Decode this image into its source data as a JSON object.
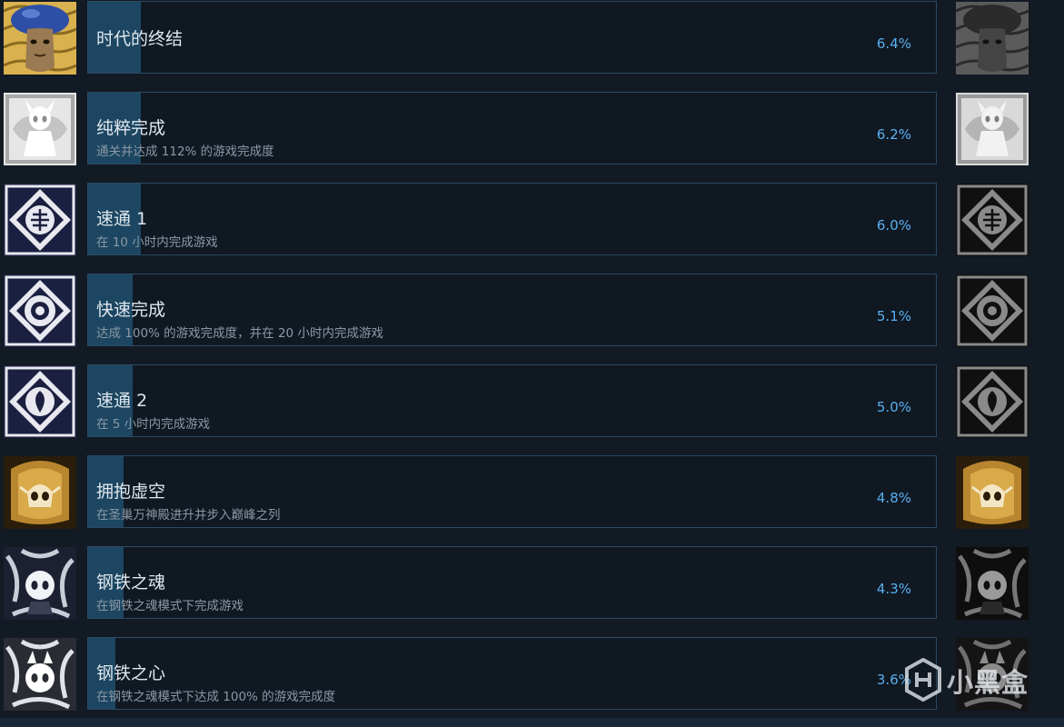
{
  "achievements": [
    {
      "title": "时代的终结",
      "description": "",
      "percent": "6.4%",
      "percent_value": 6.4,
      "icon": "mushroom-elder-icon",
      "locked_icon": "mushroom-elder-gray-icon"
    },
    {
      "title": "纯粹完成",
      "description": "通关并达成 112% 的游戏完成度",
      "percent": "6.2%",
      "percent_value": 6.2,
      "icon": "white-knight-icon",
      "locked_icon": "white-knight-gray-icon"
    },
    {
      "title": "速通 1",
      "description": "在 10 小时内完成游戏",
      "percent": "6.0%",
      "percent_value": 6.0,
      "icon": "speedrun-crest-icon",
      "locked_icon": "speedrun-crest-gray-icon"
    },
    {
      "title": "快速完成",
      "description": "达成 100% 的游戏完成度，并在 20 小时内完成游戏",
      "percent": "5.1%",
      "percent_value": 5.1,
      "icon": "speed-completion-icon",
      "locked_icon": "speed-completion-gray-icon"
    },
    {
      "title": "速通 2",
      "description": "在 5 小时内完成游戏",
      "percent": "5.0%",
      "percent_value": 5.0,
      "icon": "speedrun-leaf-icon",
      "locked_icon": "speedrun-leaf-gray-icon"
    },
    {
      "title": "拥抱虚空",
      "description": "在圣巢万神殿进升并步入巅峰之列",
      "percent": "4.8%",
      "percent_value": 4.8,
      "icon": "golden-skull-icon",
      "locked_icon": "golden-skull-gray-icon"
    },
    {
      "title": "钢铁之魂",
      "description": "在钢铁之魂模式下完成游戏",
      "percent": "4.3%",
      "percent_value": 4.3,
      "icon": "steel-soul-icon",
      "locked_icon": "steel-soul-gray-icon"
    },
    {
      "title": "钢铁之心",
      "description": "在钢铁之魂模式下达成 100% 的游戏完成度",
      "percent": "3.6%",
      "percent_value": 3.6,
      "icon": "steel-heart-icon",
      "locked_icon": "steel-heart-gray-icon"
    }
  ],
  "watermark": {
    "text": "小黑盒",
    "icon": "heybox-logo-icon"
  },
  "colors": {
    "background": "#121a24",
    "card_border": "#2a4a62",
    "progress_fill": "#1c4661",
    "title_text": "#dfe7ee",
    "description_text": "#8b98a5",
    "percent_text": "#5ab0f0"
  }
}
